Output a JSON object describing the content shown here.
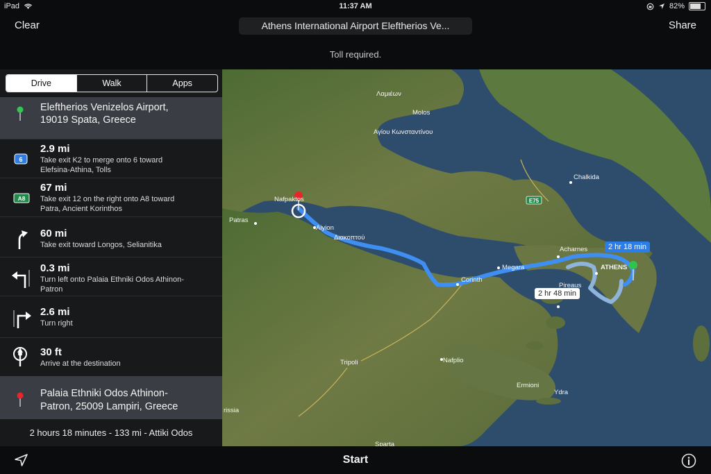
{
  "status_bar": {
    "device": "iPad",
    "time": "11:37 AM",
    "battery": "82%",
    "battery_level": 0.82
  },
  "nav": {
    "clear_label": "Clear",
    "share_label": "Share",
    "destination_field": "Athens International Airport Eleftherios Ve..."
  },
  "notice": "Toll required.",
  "mode_tabs": [
    {
      "label": "Drive",
      "selected": true
    },
    {
      "label": "Walk",
      "selected": false
    },
    {
      "label": "Apps",
      "selected": false
    }
  ],
  "origin": {
    "line1": "Eleftherios Venizelos Airport,",
    "line2": "19019 Spata, Greece"
  },
  "steps": [
    {
      "icon": "highway-6-icon",
      "shield": "6",
      "distance": "2.9 mi",
      "line1": "Take exit K2 to merge onto 6 toward",
      "line2": "Elefsina-Athina, Tolls"
    },
    {
      "icon": "highway-a8-icon",
      "shield": "A8",
      "distance": "67 mi",
      "line1": "Take exit 12 on the right onto A8 toward",
      "line2": "Patra, Ancient Korinthos"
    },
    {
      "icon": "exit-right-arrow-icon",
      "distance": "60 mi",
      "line1": "Take exit toward Longos, Selianitika",
      "line2": ""
    },
    {
      "icon": "turn-left-arrow-icon",
      "distance": "0.3 mi",
      "line1": "Turn left onto Palaia Ethniki Odos Athinon-",
      "line2": "Patron"
    },
    {
      "icon": "turn-right-arrow-icon",
      "distance": "2.6 mi",
      "line1": "Turn right",
      "line2": ""
    },
    {
      "icon": "destination-icon",
      "distance": "30 ft",
      "line1": "Arrive at the destination",
      "line2": ""
    }
  ],
  "destination": {
    "line1": "Palaia Ethniki Odos Athinon-",
    "line2": "Patron, 25009 Lampiri, Greece"
  },
  "summary": "2 hours 18 minutes - 133 mi - Attiki Odos",
  "bottom": {
    "start_label": "Start"
  },
  "map": {
    "places": [
      "Λαμιέων",
      "Molos",
      "Αγίου Κωνσταντίνου",
      "Chalkida",
      "Nafpaktos",
      "Patras",
      "Aiyion",
      "Διακοπτού",
      "Acharnes",
      "ATHENS",
      "Megara",
      "Corinth",
      "Pireaus",
      "Tripoli",
      "Nafplio",
      "Ermioni",
      "Ydra",
      "rissia",
      "Sparta"
    ],
    "highway_shield": "E75",
    "route_primary_time": "2 hr 18 min",
    "route_alt_time": "2 hr 48 min",
    "colors": {
      "route": "#3f8ff3",
      "alt_route": "#8eb4dc",
      "start_pin": "#2fc44d",
      "end_pin": "#e8262a"
    }
  }
}
